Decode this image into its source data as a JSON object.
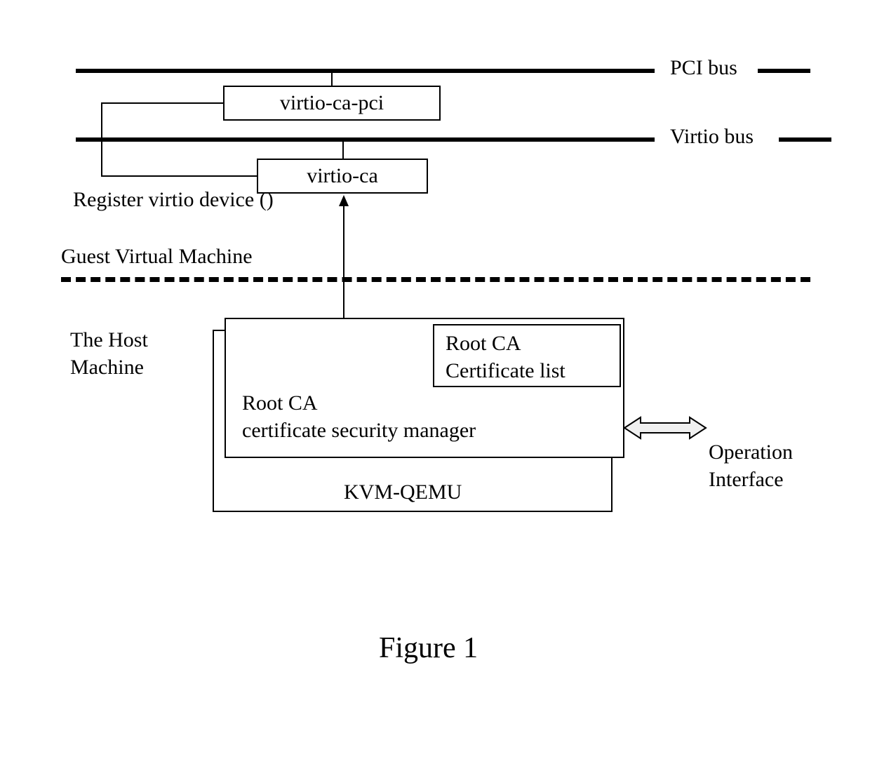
{
  "diagram": {
    "buses": {
      "pci": {
        "label": "PCI bus"
      },
      "virtio": {
        "label": "Virtio bus"
      }
    },
    "boxes": {
      "virtio_ca_pci": "virtio-ca-pci",
      "virtio_ca": "virtio-ca",
      "root_ca_cert_list": "Root CA\nCertificate list",
      "root_ca_manager": "Root CA\ncertificate security manager",
      "kvm_qemu": "KVM-QEMU"
    },
    "labels": {
      "register_device": "Register virtio device ()",
      "guest_vm": "Guest Virtual Machine",
      "host_machine": "The Host\nMachine",
      "operation_interface": "Operation\nInterface"
    },
    "caption": "Figure 1"
  }
}
